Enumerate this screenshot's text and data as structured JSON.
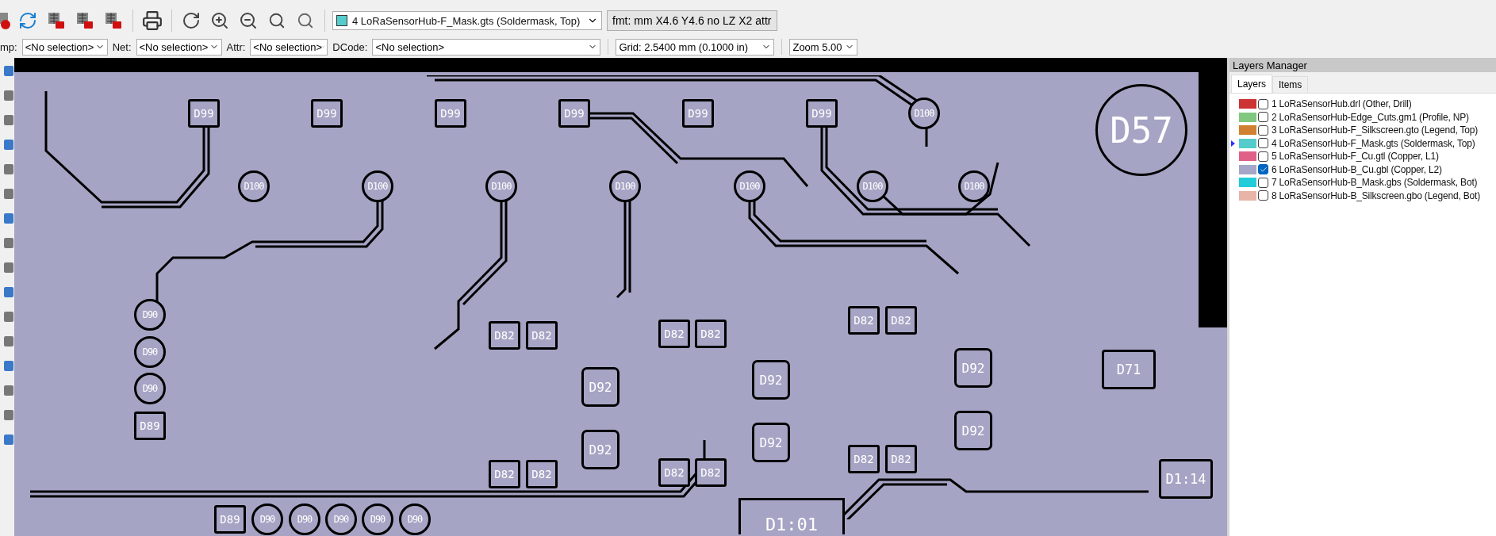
{
  "toolbar": {
    "layer_select": {
      "value": "4 LoRaSensorHub-F_Mask.gts (Soldermask, Top)",
      "color": "#55cccc"
    },
    "format_button": "fmt: mm X4.6 Y4.6 no LZ X2 attr"
  },
  "filters": [
    {
      "label": "mp:",
      "value": "<No selection>"
    },
    {
      "label": "Net:",
      "value": "<No selection>"
    },
    {
      "label": "Attr:",
      "value": "<No selection>"
    },
    {
      "label": "DCode:",
      "value": "<No selection>"
    },
    {
      "value": "Grid: 2.5400 mm (0.1000 in)"
    },
    {
      "value": "Zoom 5.00"
    }
  ],
  "canvas": {
    "pads": [
      {
        "label": "D99",
        "kind": "square"
      },
      {
        "label": "D99",
        "kind": "square"
      },
      {
        "label": "D99",
        "kind": "square"
      },
      {
        "label": "D99",
        "kind": "square"
      },
      {
        "label": "D99",
        "kind": "square"
      },
      {
        "label": "D99",
        "kind": "square"
      },
      {
        "label": "D100",
        "kind": "round"
      },
      {
        "label": "D57",
        "kind": "big-round"
      },
      {
        "label": "D100",
        "kind": "round"
      },
      {
        "label": "D100",
        "kind": "round"
      },
      {
        "label": "D100",
        "kind": "round"
      },
      {
        "label": "D100",
        "kind": "round"
      },
      {
        "label": "D100",
        "kind": "round"
      },
      {
        "label": "D100",
        "kind": "round"
      },
      {
        "label": "D100",
        "kind": "round"
      },
      {
        "label": "D90",
        "kind": "round"
      },
      {
        "label": "D90",
        "kind": "round"
      },
      {
        "label": "D90",
        "kind": "round"
      },
      {
        "label": "D89",
        "kind": "square"
      },
      {
        "label": "D82",
        "kind": "square"
      },
      {
        "label": "D82",
        "kind": "square"
      },
      {
        "label": "D82",
        "kind": "square"
      },
      {
        "label": "D82",
        "kind": "square"
      },
      {
        "label": "D82",
        "kind": "square"
      },
      {
        "label": "D82",
        "kind": "square"
      },
      {
        "label": "D71",
        "kind": "chip"
      },
      {
        "label": "D92",
        "kind": "large"
      },
      {
        "label": "D92",
        "kind": "large"
      },
      {
        "label": "D92",
        "kind": "large"
      },
      {
        "label": "D92",
        "kind": "large"
      },
      {
        "label": "D92",
        "kind": "large"
      },
      {
        "label": "D92",
        "kind": "large"
      },
      {
        "label": "D82",
        "kind": "square"
      },
      {
        "label": "D82",
        "kind": "square"
      },
      {
        "label": "D82",
        "kind": "square"
      },
      {
        "label": "D82",
        "kind": "square"
      },
      {
        "label": "D82",
        "kind": "square"
      },
      {
        "label": "D82",
        "kind": "square"
      },
      {
        "label": "D1:14",
        "kind": "chip"
      },
      {
        "label": "D89",
        "kind": "square"
      },
      {
        "label": "D90",
        "kind": "round"
      },
      {
        "label": "D90",
        "kind": "round"
      },
      {
        "label": "D90",
        "kind": "round"
      },
      {
        "label": "D90",
        "kind": "round"
      },
      {
        "label": "D90",
        "kind": "round"
      },
      {
        "label": "D1:01",
        "kind": "block"
      }
    ]
  },
  "layers_manager": {
    "title": "Layers Manager",
    "tabs": [
      {
        "label": "Layers",
        "selected": true
      },
      {
        "label": "Items",
        "selected": false
      }
    ],
    "layers": [
      {
        "label": "1 LoRaSensorHub.drl (Other, Drill)",
        "color": "#cc3333",
        "checked": false,
        "selected": false
      },
      {
        "label": "2 LoRaSensorHub-Edge_Cuts.gm1 (Profile, NP)",
        "color": "#80c880",
        "checked": false,
        "selected": false
      },
      {
        "label": "3 LoRaSensorHub-F_Silkscreen.gto (Legend, Top)",
        "color": "#d08030",
        "checked": false,
        "selected": false
      },
      {
        "label": "4 LoRaSensorHub-F_Mask.gts (Soldermask, Top)",
        "color": "#55cccc",
        "checked": false,
        "selected": true
      },
      {
        "label": "5 LoRaSensorHub-F_Cu.gtl (Copper, L1)",
        "color": "#e06088",
        "checked": false,
        "selected": false
      },
      {
        "label": "6 LoRaSensorHub-B_Cu.gbl (Copper, L2)",
        "color": "#a6a6c8",
        "checked": true,
        "selected": false
      },
      {
        "label": "7 LoRaSensorHub-B_Mask.gbs (Soldermask, Bot)",
        "color": "#22ccd8",
        "checked": false,
        "selected": false
      },
      {
        "label": "8 LoRaSensorHub-B_Silkscreen.gbo (Legend, Bot)",
        "color": "#e8b4a8",
        "checked": false,
        "selected": false
      }
    ]
  }
}
